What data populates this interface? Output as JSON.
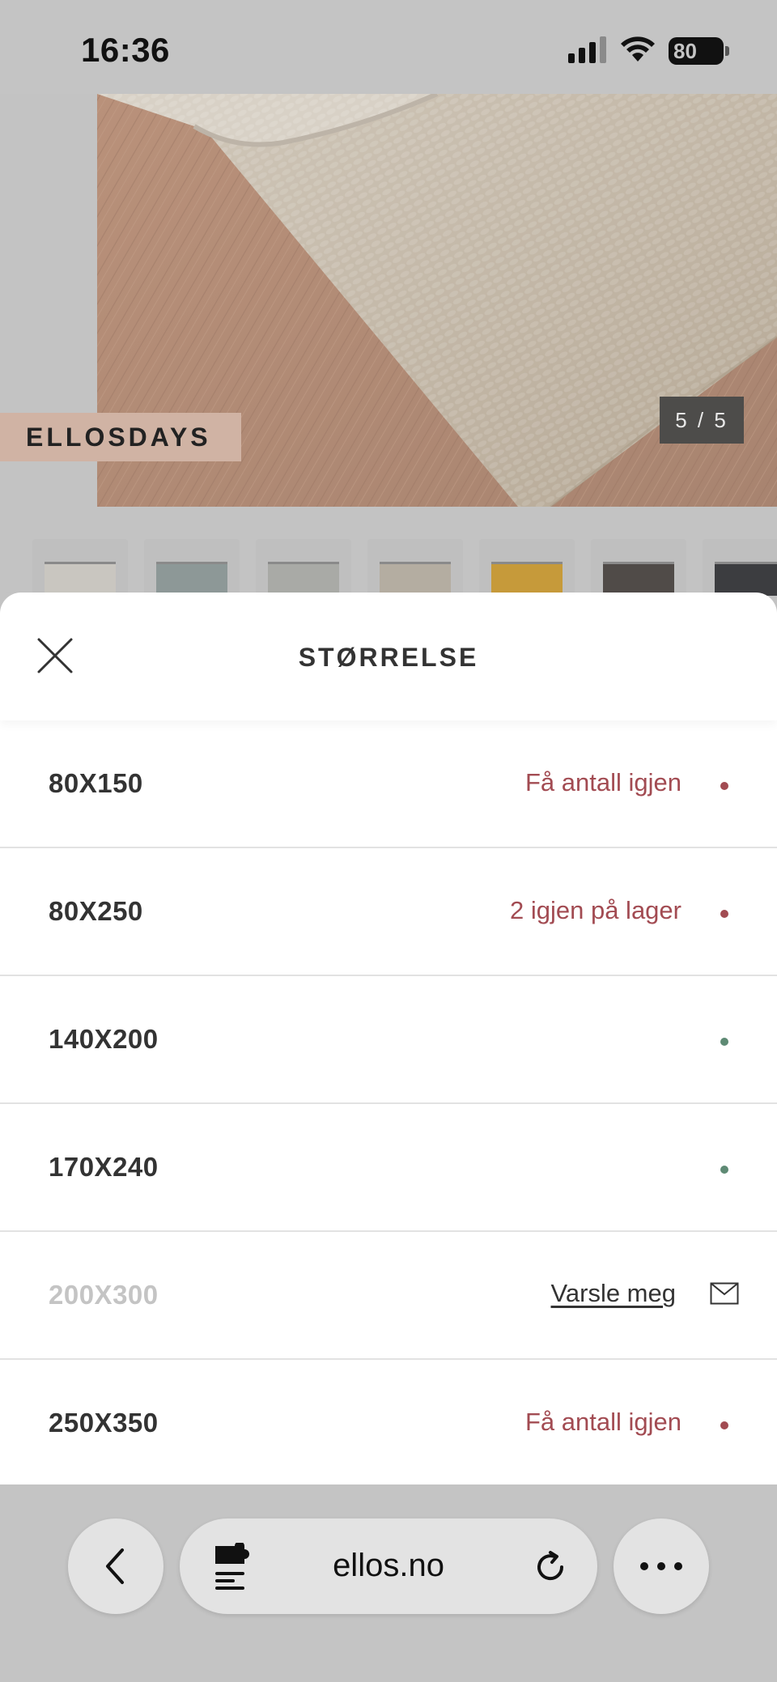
{
  "status_bar": {
    "time": "16:36",
    "battery": "80"
  },
  "hero": {
    "promo_badge": "ELLOSDAYS",
    "image_counter": "5 / 5"
  },
  "thumbnails": [
    {
      "color": "#c9c6c0"
    },
    {
      "color": "#8d9897"
    },
    {
      "color": "#a9aaa6"
    },
    {
      "color": "#b4ada1"
    },
    {
      "color": "#c69a3a"
    },
    {
      "color": "#504b48"
    },
    {
      "color": "#3c3d40"
    }
  ],
  "sheet": {
    "title": "STØRRELSE",
    "sizes": [
      {
        "label": "80X150",
        "status": "Få antall igjen",
        "indicator": "red"
      },
      {
        "label": "80X250",
        "status": "2 igjen på lager",
        "indicator": "red"
      },
      {
        "label": "140X200",
        "status": "",
        "indicator": "green"
      },
      {
        "label": "170X240",
        "status": "",
        "indicator": "green"
      },
      {
        "label": "200X300",
        "notify": "Varsle meg",
        "disabled": true
      },
      {
        "label": "250X350",
        "status": "Få antall igjen",
        "indicator": "red"
      }
    ]
  },
  "browser": {
    "url": "ellos.no"
  },
  "colors": {
    "low_stock": "#a24b52",
    "in_stock": "#5e8a74",
    "promo_bg": "#d0b3a4"
  }
}
